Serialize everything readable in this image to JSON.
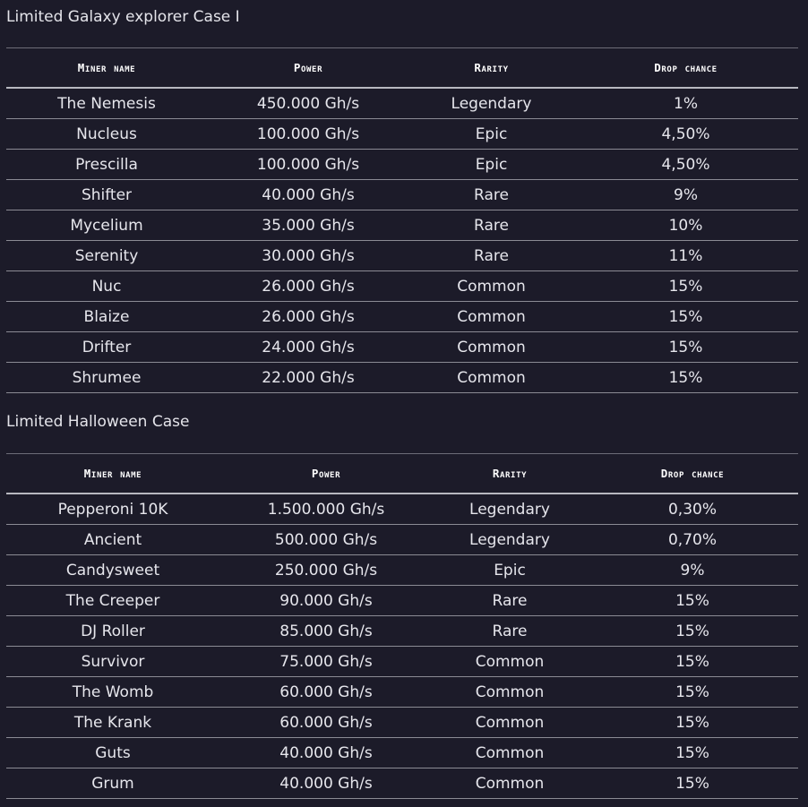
{
  "sections": [
    {
      "title": "Limited Galaxy explorer Case I",
      "headers": [
        "Miner name",
        "Power",
        "Rarity",
        "Drop chance"
      ],
      "rows": [
        [
          "The Nemesis",
          "450.000 Gh/s",
          "Legendary",
          "1%"
        ],
        [
          "Nucleus",
          "100.000 Gh/s",
          "Epic",
          "4,50%"
        ],
        [
          "Prescilla",
          "100.000 Gh/s",
          "Epic",
          "4,50%"
        ],
        [
          "Shifter",
          "40.000 Gh/s",
          "Rare",
          "9%"
        ],
        [
          "Mycelium",
          "35.000 Gh/s",
          "Rare",
          "10%"
        ],
        [
          "Serenity",
          "30.000 Gh/s",
          "Rare",
          "11%"
        ],
        [
          "Nuc",
          "26.000 Gh/s",
          "Common",
          "15%"
        ],
        [
          "Blaize",
          "26.000 Gh/s",
          "Common",
          "15%"
        ],
        [
          "Drifter",
          "24.000 Gh/s",
          "Common",
          "15%"
        ],
        [
          "Shrumee",
          "22.000 Gh/s",
          "Common",
          "15%"
        ]
      ]
    },
    {
      "title": "Limited Halloween Case",
      "headers": [
        "Miner name",
        "Power",
        "Rarity",
        "Drop chance"
      ],
      "rows": [
        [
          "Pepperoni 10K",
          "1.500.000 Gh/s",
          "Legendary",
          "0,30%"
        ],
        [
          "Ancient",
          "500.000 Gh/s",
          "Legendary",
          "0,70%"
        ],
        [
          "Candysweet",
          "250.000 Gh/s",
          "Epic",
          "9%"
        ],
        [
          "The Creeper",
          "90.000 Gh/s",
          "Rare",
          "15%"
        ],
        [
          "DJ Roller",
          "85.000 Gh/s",
          "Rare",
          "15%"
        ],
        [
          "Survivor",
          "75.000 Gh/s",
          "Common",
          "15%"
        ],
        [
          "The Womb",
          "60.000 Gh/s",
          "Common",
          "15%"
        ],
        [
          "The Krank",
          "60.000 Gh/s",
          "Common",
          "15%"
        ],
        [
          "Guts",
          "40.000 Gh/s",
          "Common",
          "15%"
        ],
        [
          "Grum",
          "40.000 Gh/s",
          "Common",
          "15%"
        ]
      ]
    }
  ]
}
